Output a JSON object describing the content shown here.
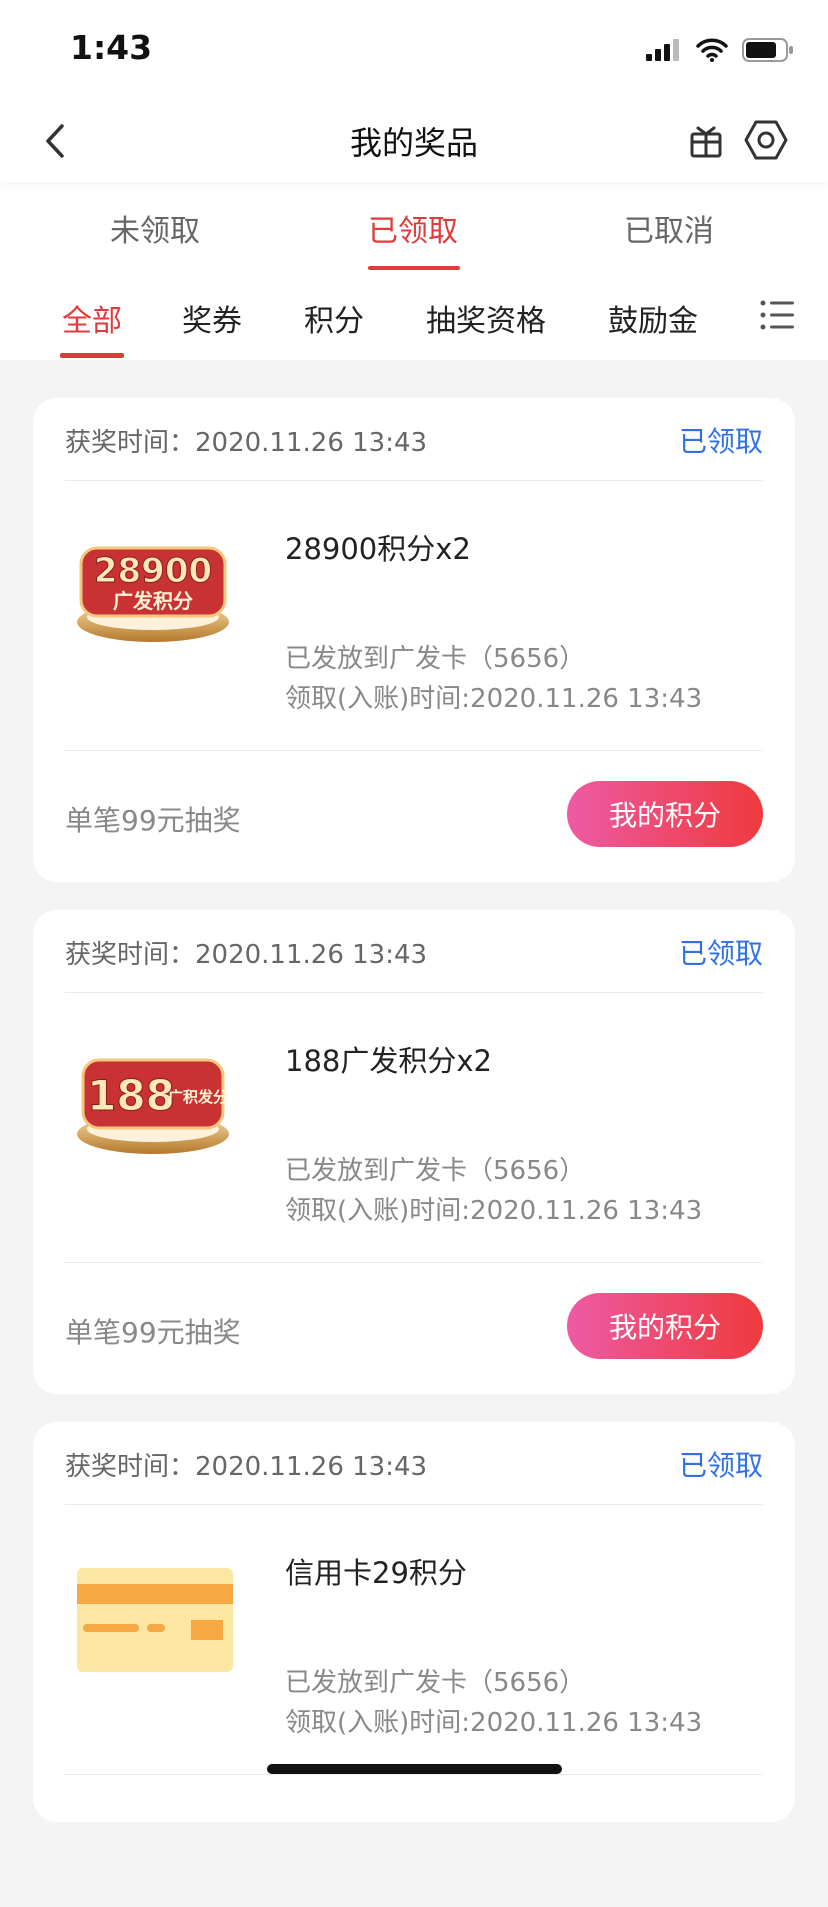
{
  "status_bar": {
    "time": "1:43",
    "icons": [
      "cellular-signal-icon",
      "wifi-icon",
      "battery-icon"
    ]
  },
  "nav": {
    "title": "我的奖品",
    "icons": [
      "back-chevron-icon",
      "gift-icon",
      "settings-hexagon-icon"
    ]
  },
  "status_tabs": [
    {
      "label": "未领取",
      "active": false
    },
    {
      "label": "已领取",
      "active": true
    },
    {
      "label": "已取消",
      "active": false
    }
  ],
  "category_tabs": [
    {
      "label": "全部",
      "active": true
    },
    {
      "label": "奖券",
      "active": false
    },
    {
      "label": "积分",
      "active": false
    },
    {
      "label": "抽奖资格",
      "active": false
    },
    {
      "label": "鼓励金",
      "active": false
    }
  ],
  "colors": {
    "accent_red": "#e23a3a",
    "status_blue": "#2f6fe8",
    "button_gradient_start": "#ee5aa4",
    "button_gradient_end": "#ee3a3c",
    "background": "#f4f4f4"
  },
  "prizes": [
    {
      "win_time": "获奖时间：2020.11.26 13:43",
      "status": "已领取",
      "image_text_number": "28900",
      "image_text_label": "广发积分",
      "name": "28900积分x2",
      "delivery": "已发放到广发卡（5656）",
      "received_time": "领取(入账)时间:2020.11.26 13:43",
      "promo": "单笔99元抽奖",
      "button": "我的积分"
    },
    {
      "win_time": "获奖时间：2020.11.26 13:43",
      "status": "已领取",
      "image_text_number": "188",
      "image_text_label": "广积发分",
      "name": "188广发积分x2",
      "delivery": "已发放到广发卡（5656）",
      "received_time": "领取(入账)时间:2020.11.26 13:43",
      "promo": "单笔99元抽奖",
      "button": "我的积分"
    },
    {
      "win_time": "获奖时间：2020.11.26 13:43",
      "status": "已领取",
      "image": "credit-card-icon",
      "name": "信用卡29积分",
      "delivery": "已发放到广发卡（5656）",
      "received_time": "领取(入账)时间:2020.11.26 13:43"
    }
  ]
}
